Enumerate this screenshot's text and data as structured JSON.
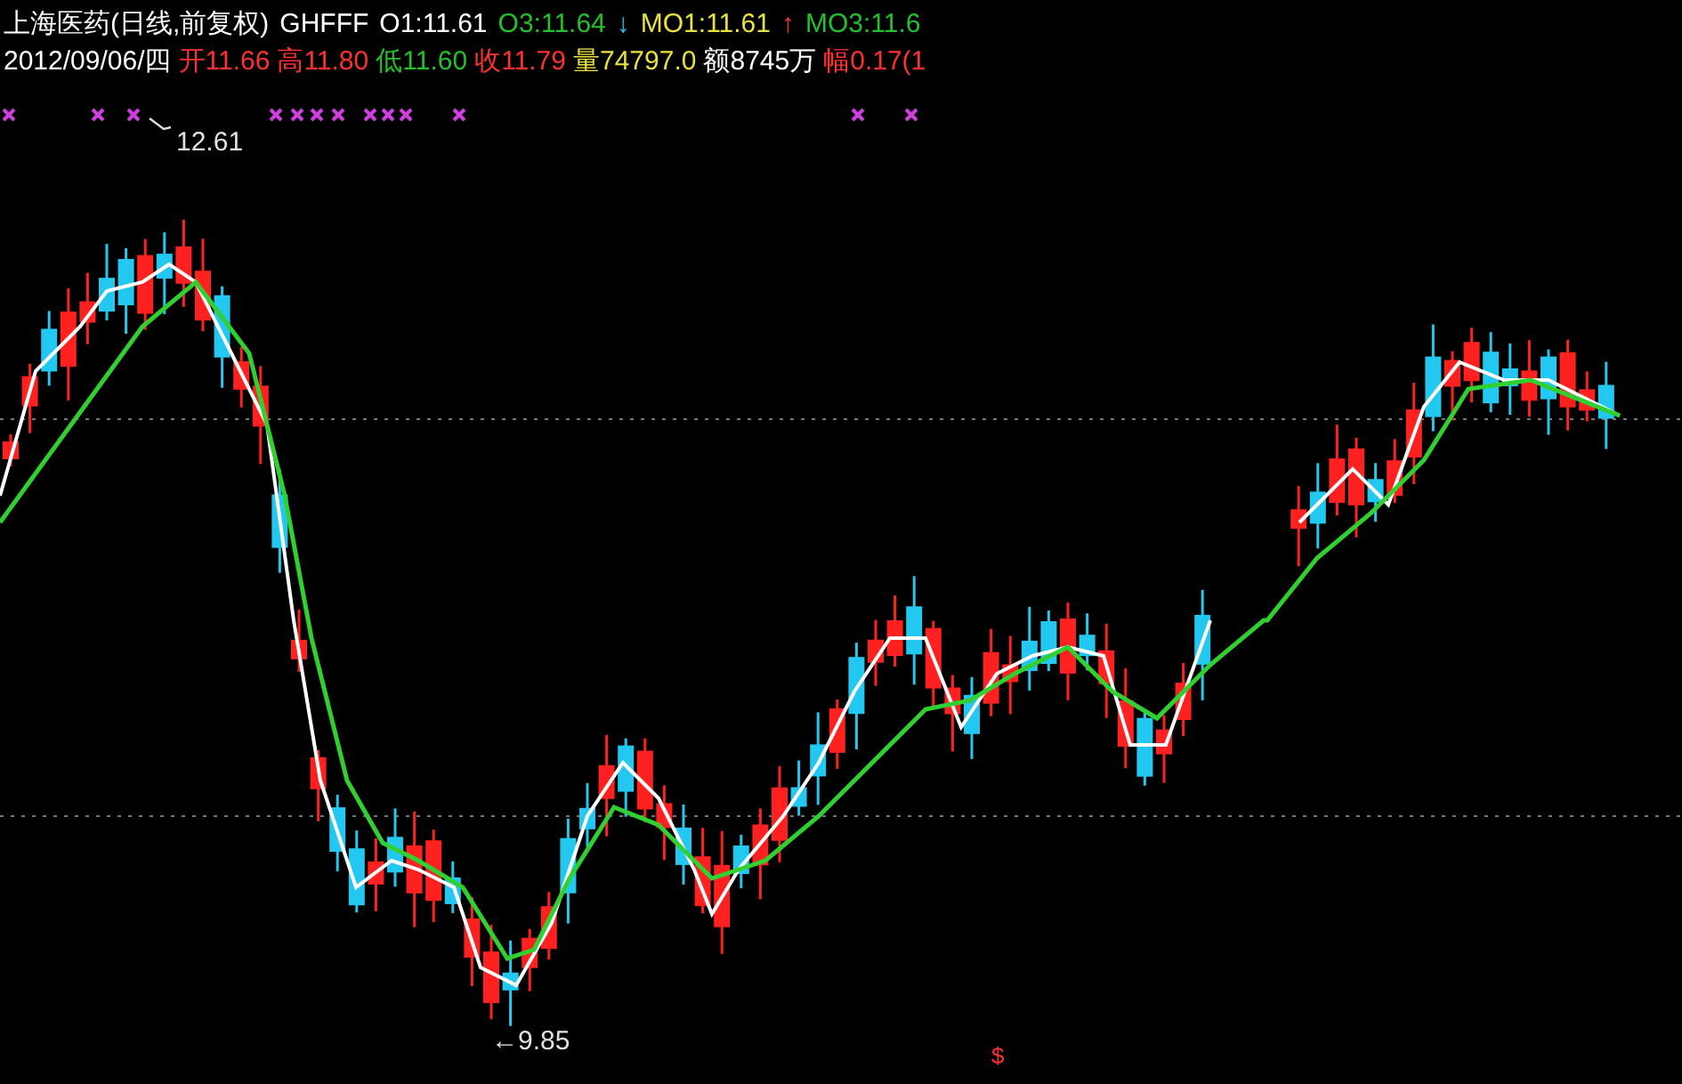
{
  "header": {
    "line_1": [
      {
        "text": "上海医药(日线,前复权)",
        "color": "#ffffff"
      },
      {
        "text": "GHFFF",
        "color": "#ffffff"
      },
      {
        "text": "O1:11.61",
        "color": "#ffffff"
      },
      {
        "text": "O3:11.64",
        "color": "#22c02a"
      },
      {
        "text": "↓",
        "color": "#22c8f0"
      },
      {
        "text": "MO1:11.61",
        "color": "#e8e040"
      },
      {
        "text": "↑",
        "color": "#ff3030"
      },
      {
        "text": "MO3:11.6",
        "color": "#22c02a"
      }
    ],
    "line_2": [
      {
        "text": "2012/09/06/四",
        "color": "#ffffff"
      },
      {
        "text": "开11.66",
        "color": "#ff3030"
      },
      {
        "text": "高11.80",
        "color": "#ff3030"
      },
      {
        "text": "低11.60",
        "color": "#22c02a"
      },
      {
        "text": "收11.79",
        "color": "#ff3030"
      },
      {
        "text": "量74797.0",
        "color": "#e8e040"
      },
      {
        "text": "额8745万",
        "color": "#ffffff"
      },
      {
        "text": "幅0.17(1",
        "color": "#ff3030"
      }
    ]
  },
  "chart": {
    "high_label": "12.61",
    "low_label": "←9.85",
    "signal_mark": "$"
  }
}
